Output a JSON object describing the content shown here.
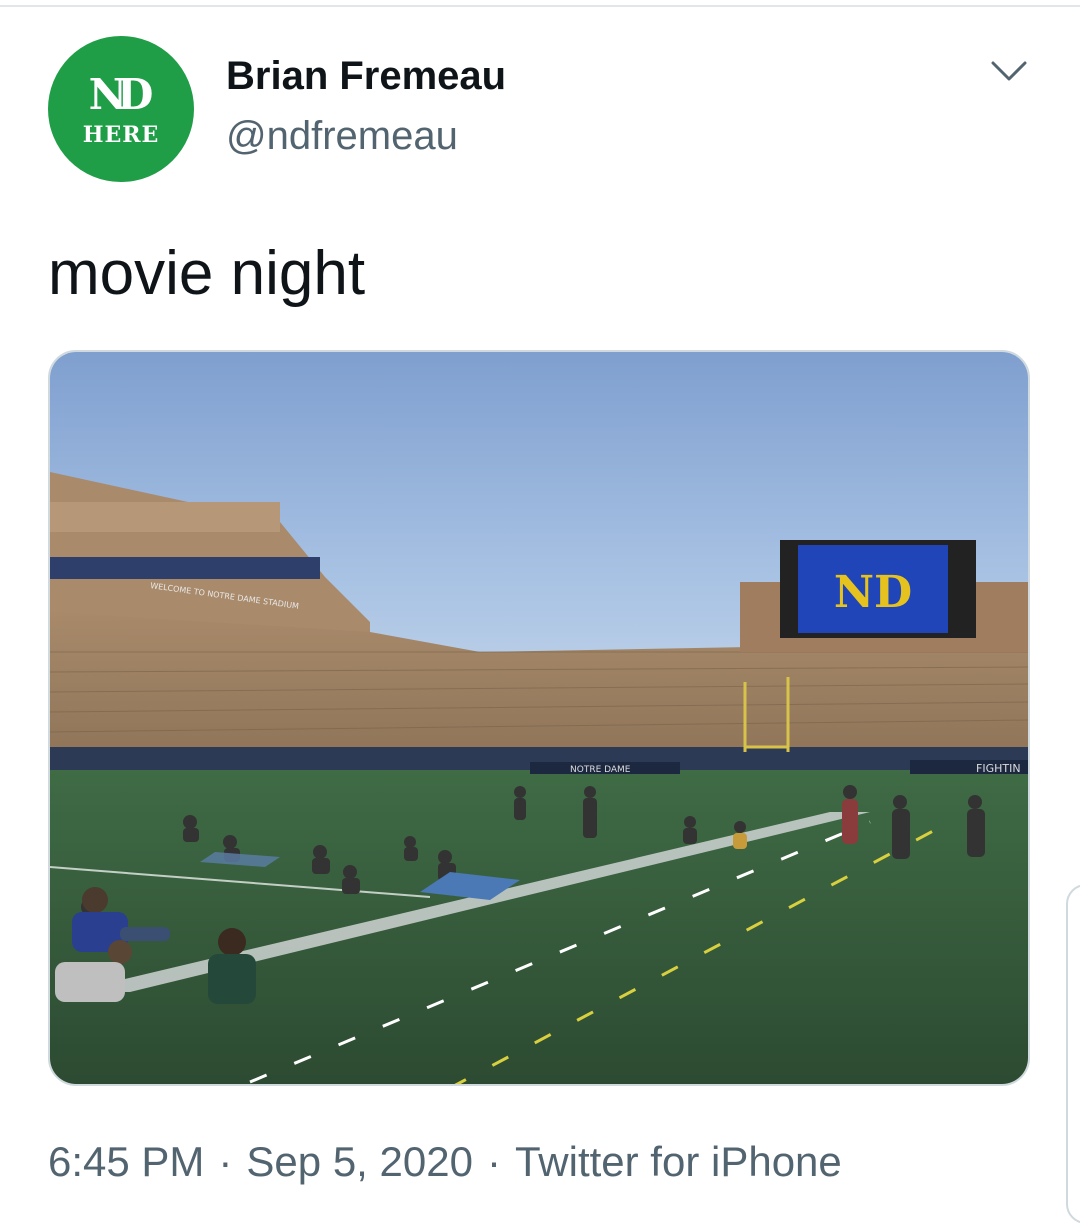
{
  "author": {
    "name": "Brian Fremeau",
    "handle": "@ndfremeau",
    "avatar": {
      "monogram": "ND",
      "caption": "HERE",
      "color": "#1f9d47"
    }
  },
  "tweet": {
    "text": "movie night",
    "photo": {
      "screen_logo": "ND",
      "banner_left": "NOTRE DAME",
      "banner_right": "FIGHTIN",
      "upper_deck_banner": "WELCOME TO NOTRE DAME STADIUM"
    }
  },
  "meta": {
    "time": "6:45 PM",
    "date": "Sep 5, 2020",
    "source": "Twitter for iPhone",
    "separator": "·"
  },
  "icons": {
    "menu": "chevron-down-icon"
  }
}
